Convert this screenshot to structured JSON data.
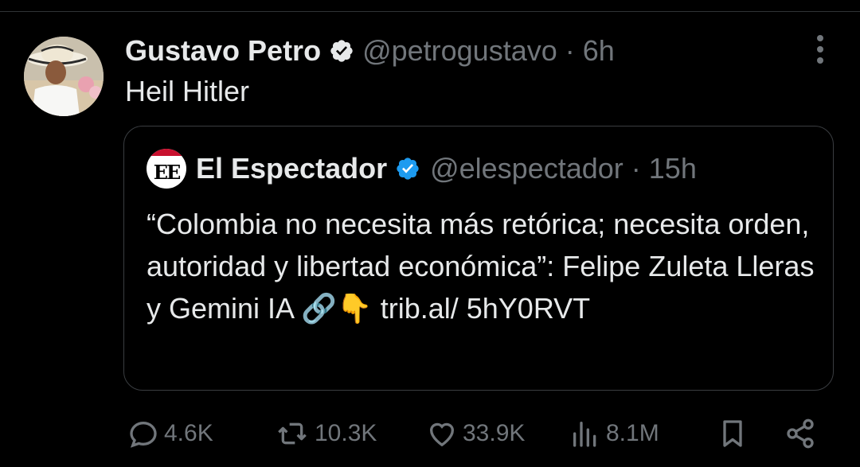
{
  "tweet": {
    "author_name": "Gustavo Petro",
    "handle_time": "@petrogustavo · 6h",
    "text": "Heil Hitler"
  },
  "quote": {
    "avatar_text": "EE",
    "author_name": "El Espectador",
    "handle_time": "@elespectador · 15h",
    "text": "“Colombia no necesita más retórica; necesita orden, autoridad y libertad económica”: Felipe Zuleta Lleras y Gemini IA 🔗👇 trib.al/ 5hY0RVT"
  },
  "actions": {
    "replies": "4.6K",
    "reposts": "10.3K",
    "likes": "33.9K",
    "views": "8.1M"
  },
  "colors": {
    "background": "#000000",
    "text": "#e7e9ea",
    "muted": "#71767b",
    "verified": "#1d9bf0",
    "quote_avatar_red": "#c8102e"
  },
  "icons": [
    "verified-badge-icon",
    "more-options-icon",
    "reply-icon",
    "repost-icon",
    "like-icon",
    "views-icon",
    "bookmark-icon",
    "share-icon"
  ]
}
